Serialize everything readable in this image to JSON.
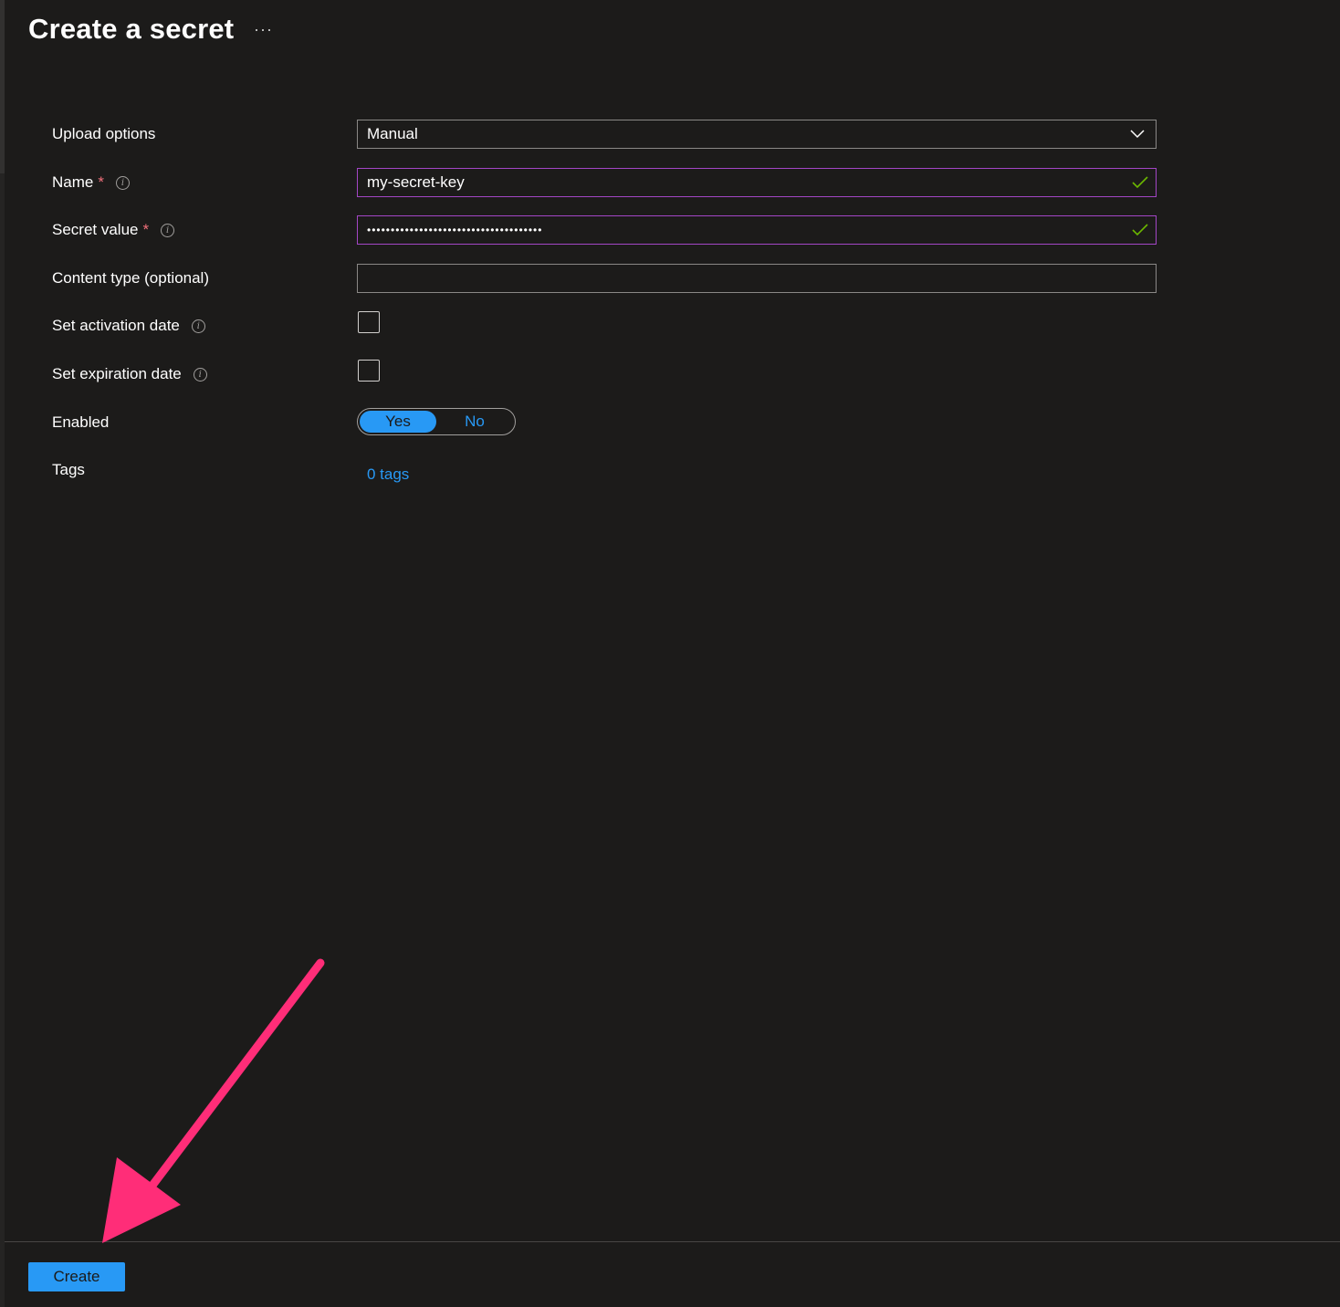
{
  "header": {
    "title": "Create a secret",
    "more_label": "···"
  },
  "form": {
    "upload_options": {
      "label": "Upload options",
      "value": "Manual"
    },
    "name": {
      "label": "Name",
      "required_mark": "*",
      "value": "my-secret-key"
    },
    "secret_value": {
      "label": "Secret value",
      "required_mark": "*",
      "value": "•••••••••••••••••••••••••••••••••••••"
    },
    "content_type": {
      "label": "Content type (optional)",
      "value": ""
    },
    "activation_date": {
      "label": "Set activation date",
      "checked": false
    },
    "expiration_date": {
      "label": "Set expiration date",
      "checked": false
    },
    "enabled": {
      "label": "Enabled",
      "yes_label": "Yes",
      "no_label": "No",
      "selected": "Yes"
    },
    "tags": {
      "label": "Tags",
      "link_label": "0 tags"
    }
  },
  "footer": {
    "create_label": "Create"
  },
  "colors": {
    "background": "#1c1b1a",
    "accent": "#2899f5",
    "valid_border": "#a346c6",
    "valid_check": "#6bb700",
    "required": "#f1707b",
    "annotation_arrow": "#ff2d78"
  },
  "icons": [
    "info-icon",
    "chevron-down-icon",
    "checkmark-icon",
    "ellipsis-icon"
  ]
}
